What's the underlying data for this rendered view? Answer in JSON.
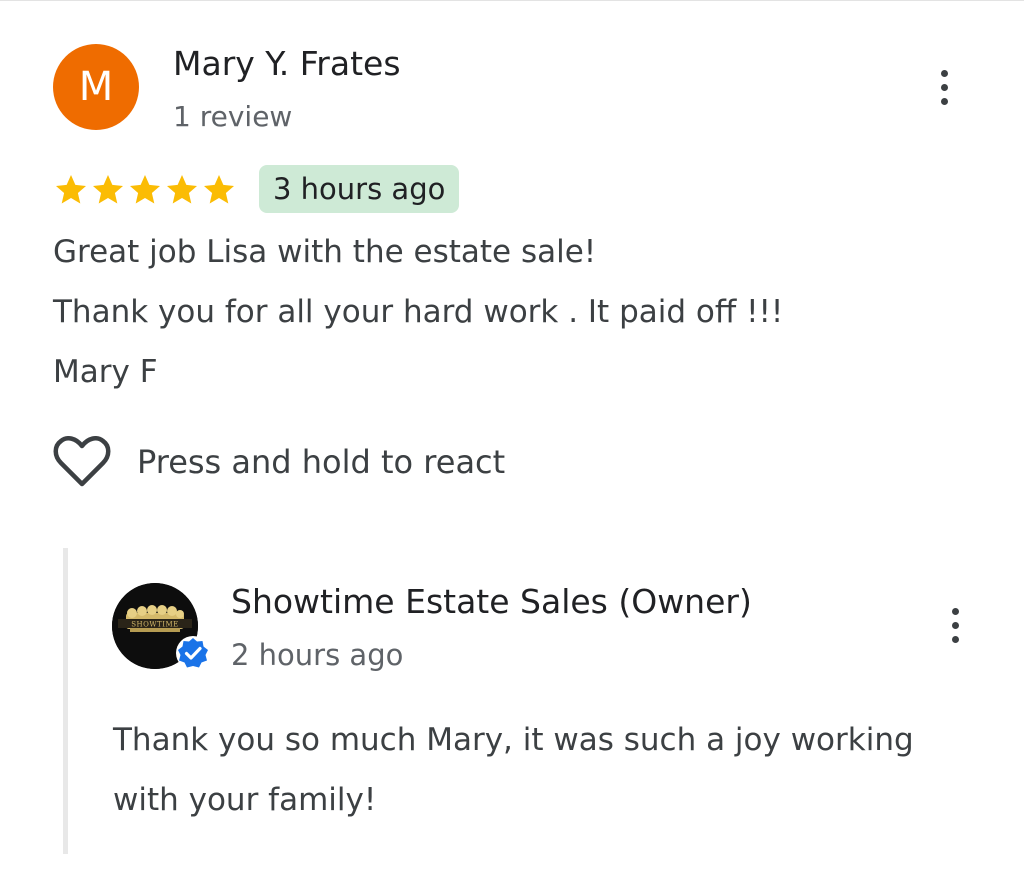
{
  "review": {
    "avatar_initial": "M",
    "avatar_color": "#ef6c00",
    "reviewer_name": "Mary Y. Frates",
    "review_count": "1 review",
    "rating": 5,
    "rating_max": 5,
    "star_color": "#fbbc04",
    "time_ago": "3 hours ago",
    "text_lines": [
      "Great job Lisa with the estate sale!",
      "Thank you for all your hard work . It paid off !!!",
      "Mary F"
    ],
    "react_label": "Press and hold to react",
    "react_icon": "heart-outline-icon",
    "more_icon": "more-vert-icon"
  },
  "reply": {
    "owner_name": "Showtime Estate Sales (Owner)",
    "time_ago": "2 hours ago",
    "avatar_logo_text": "SHOWTIME",
    "verified_icon": "verified-badge-icon",
    "verified_color": "#1a73e8",
    "text_lines": [
      "Thank you so much Mary, it was such a joy working",
      "with your family!"
    ],
    "more_icon": "more-vert-icon"
  }
}
